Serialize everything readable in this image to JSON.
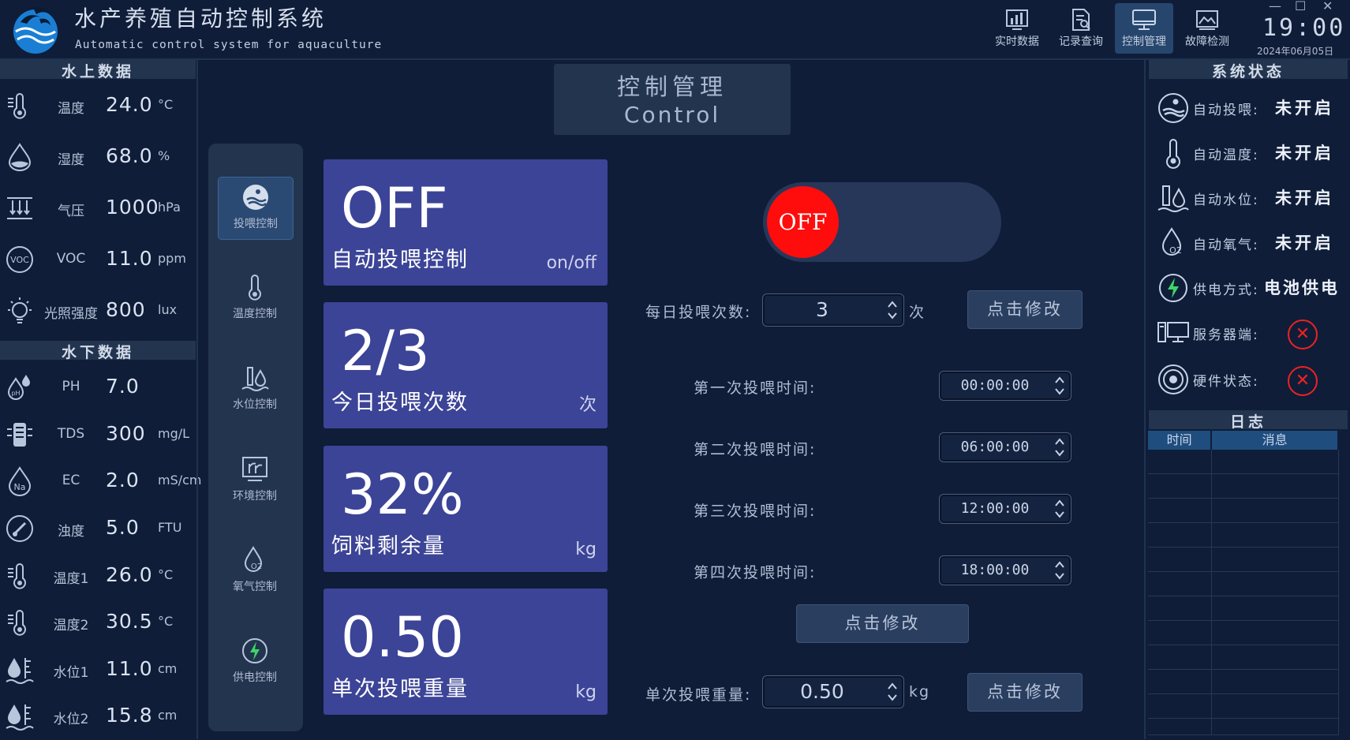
{
  "header": {
    "title": "水产养殖自动控制系统",
    "subtitle": "Automatic control system for aquaculture",
    "nav": [
      {
        "label": "实时数据",
        "icon": "bar-chart-icon",
        "active": false
      },
      {
        "label": "记录查询",
        "icon": "document-search-icon",
        "active": false
      },
      {
        "label": "控制管理",
        "icon": "monitor-icon",
        "active": true
      },
      {
        "label": "故障检测",
        "icon": "image-icon",
        "active": false
      }
    ],
    "window_controls": [
      "—",
      "☐",
      "✕"
    ],
    "time": "19:00:37",
    "date": "2024年06月05日"
  },
  "left_panel": {
    "above_water_title": "水上数据",
    "above_water": [
      {
        "label": "温度",
        "value": "24.0",
        "unit": "°C",
        "icon": "thermometer-icon"
      },
      {
        "label": "湿度",
        "value": "68.0",
        "unit": "%",
        "icon": "humidity-drop-icon"
      },
      {
        "label": "气压",
        "value": "1000",
        "unit": "hPa",
        "icon": "pressure-icon"
      },
      {
        "label": "VOC",
        "value": "11.0",
        "unit": "ppm",
        "icon": "voc-icon"
      },
      {
        "label": "光照强度",
        "value": "800",
        "unit": "lux",
        "icon": "light-bulb-icon"
      }
    ],
    "under_water_title": "水下数据",
    "under_water": [
      {
        "label": "PH",
        "value": "7.0",
        "unit": "",
        "icon": "ph-icon"
      },
      {
        "label": "TDS",
        "value": "300",
        "unit": "mg/L",
        "icon": "tds-icon"
      },
      {
        "label": "EC",
        "value": "2.0",
        "unit": "mS/cm",
        "icon": "ec-icon"
      },
      {
        "label": "浊度",
        "value": "5.0",
        "unit": "FTU",
        "icon": "turbidity-icon"
      },
      {
        "label": "温度1",
        "value": "26.0",
        "unit": "°C",
        "icon": "thermometer-icon"
      },
      {
        "label": "温度2",
        "value": "30.5",
        "unit": "°C",
        "icon": "thermometer-icon"
      },
      {
        "label": "水位1",
        "value": "11.0",
        "unit": "cm",
        "icon": "water-level-icon"
      },
      {
        "label": "水位2",
        "value": "15.8",
        "unit": "cm",
        "icon": "water-level-icon"
      }
    ]
  },
  "control": {
    "title_cn": "控制管理",
    "title_en": "Control",
    "side_nav": [
      {
        "label": "投喂控制",
        "icon": "feeding-icon",
        "active": true
      },
      {
        "label": "温度控制",
        "icon": "thermometer-icon",
        "active": false
      },
      {
        "label": "水位控制",
        "icon": "water-level-icon",
        "active": false
      },
      {
        "label": "环境控制",
        "icon": "environment-icon",
        "active": false
      },
      {
        "label": "氧气控制",
        "icon": "oxygen-icon",
        "active": false
      },
      {
        "label": "供电控制",
        "icon": "power-icon",
        "active": false
      }
    ],
    "cards": [
      {
        "value": "OFF",
        "caption": "自动投喂控制",
        "unit": "on/off"
      },
      {
        "value": "2/3",
        "caption": "今日投喂次数",
        "unit": "次"
      },
      {
        "value": "32%",
        "caption": "饲料剩余量",
        "unit": "kg"
      },
      {
        "value": "0.50",
        "caption": "单次投喂重量",
        "unit": "kg"
      }
    ],
    "toggle_label": "OFF",
    "daily_label": "每日投喂次数:",
    "daily_value": "3",
    "daily_unit": "次",
    "modify_label": "点击修改",
    "times": [
      {
        "label": "第一次投喂时间:",
        "value": "00:00:00"
      },
      {
        "label": "第二次投喂时间:",
        "value": "06:00:00"
      },
      {
        "label": "第三次投喂时间:",
        "value": "12:00:00"
      },
      {
        "label": "第四次投喂时间:",
        "value": "18:00:00"
      }
    ],
    "weight_label": "单次投喂重量:",
    "weight_value": "0.50",
    "weight_unit": "kg"
  },
  "right_panel": {
    "status_title": "系统状态",
    "status": [
      {
        "label": "自动投喂:",
        "value": "未开启",
        "icon": "feeding-icon"
      },
      {
        "label": "自动温度:",
        "value": "未开启",
        "icon": "thermometer-icon"
      },
      {
        "label": "自动水位:",
        "value": "未开启",
        "icon": "water-level-icon"
      },
      {
        "label": "自动氧气:",
        "value": "未开启",
        "icon": "oxygen-icon"
      },
      {
        "label": "供电方式:",
        "value": "电池供电",
        "icon": "power-icon"
      },
      {
        "label": "服务器端:",
        "value": "",
        "icon": "server-icon",
        "error": true
      },
      {
        "label": "硬件状态:",
        "value": "",
        "icon": "hardware-icon",
        "error": true
      }
    ],
    "log_title": "日志",
    "log_headers": [
      "时间",
      "消息"
    ]
  }
}
